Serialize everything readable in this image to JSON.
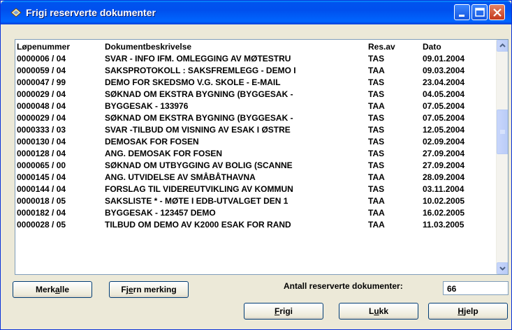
{
  "window": {
    "title": "Frigi reserverte dokumenter"
  },
  "list": {
    "headers": {
      "number": "Løpenummer",
      "description": "Dokumentbeskrivelse",
      "reserved_by": "Res.av",
      "date": "Dato"
    },
    "rows": [
      {
        "number": "0000006 / 04",
        "description": "SVAR - INFO IFM. OMLEGGING AV MØTESTRU",
        "reserved_by": "TAS",
        "date": "09.01.2004"
      },
      {
        "number": "0000059 / 04",
        "description": "SAKSPROTOKOLL : SAKSFREMLEGG - DEMO I",
        "reserved_by": "TAA",
        "date": "09.03.2004"
      },
      {
        "number": "0000047 / 99",
        "description": "DEMO FOR SKEDSMO V.G. SKOLE - E-MAIL",
        "reserved_by": "TAS",
        "date": "23.04.2004"
      },
      {
        "number": "0000029 / 04",
        "description": "SØKNAD OM EKSTRA BYGNING  (BYGGESAK -",
        "reserved_by": "TAS",
        "date": "04.05.2004"
      },
      {
        "number": "0000048 / 04",
        "description": "BYGGESAK - 133976",
        "reserved_by": "TAA",
        "date": "07.05.2004"
      },
      {
        "number": "0000029 / 04",
        "description": "SØKNAD OM EKSTRA BYGNING  (BYGGESAK -",
        "reserved_by": "TAS",
        "date": "07.05.2004"
      },
      {
        "number": "0000333 / 03",
        "description": "SVAR -TILBUD OM VISNING AV ESAK I ØSTRE",
        "reserved_by": "TAS",
        "date": "12.05.2004"
      },
      {
        "number": "0000130 / 04",
        "description": "DEMOSAK FOR FOSEN",
        "reserved_by": "TAS",
        "date": "02.09.2004"
      },
      {
        "number": "0000128 / 04",
        "description": "ANG. DEMOSAK FOR FOSEN",
        "reserved_by": "TAS",
        "date": "27.09.2004"
      },
      {
        "number": "0000065 / 00",
        "description": "SØKNAD OM UTBYGGING AV BOLIG (SCANNE",
        "reserved_by": "TAS",
        "date": "27.09.2004"
      },
      {
        "number": "0000145 / 04",
        "description": "ANG. UTVIDELSE AV SMÅBÅTHAVNA",
        "reserved_by": "TAA",
        "date": "28.09.2004"
      },
      {
        "number": "0000144 / 04",
        "description": "FORSLAG TIL VIDEREUTVIKLING AV KOMMUN",
        "reserved_by": "TAS",
        "date": "03.11.2004"
      },
      {
        "number": "0000018 / 05",
        "description": "SAKSLISTE * - MØTE I EDB-UTVALGET DEN 1",
        "reserved_by": "TAA",
        "date": "10.02.2005"
      },
      {
        "number": "0000182 / 04",
        "description": "BYGGESAK - 123457 DEMO",
        "reserved_by": "TAA",
        "date": "16.02.2005"
      },
      {
        "number": "0000028 / 05",
        "description": "TILBUD OM DEMO AV K2000 ESAK FOR RAND",
        "reserved_by": "TAA",
        "date": "11.03.2005"
      }
    ],
    "scroll_fraction": 0.35
  },
  "buttons": {
    "select_all": {
      "before": "Merk ",
      "accel": "a",
      "after": "lle"
    },
    "clear_selection": {
      "before": "Fj",
      "accel": "e",
      "after": "rn merking"
    },
    "release": {
      "before": "",
      "accel": "F",
      "after": "rigi"
    },
    "close": {
      "before": "L",
      "accel": "u",
      "after": "kk"
    },
    "help": {
      "before": "",
      "accel": "H",
      "after": "jelp"
    }
  },
  "count": {
    "label": "Antall reserverte dokumenter:",
    "value": "66"
  },
  "colors": {
    "titlebar": "#0053ee",
    "window_bg": "#ece9d8",
    "list_border": "#7f9db9",
    "close_button": "#c4381c"
  }
}
